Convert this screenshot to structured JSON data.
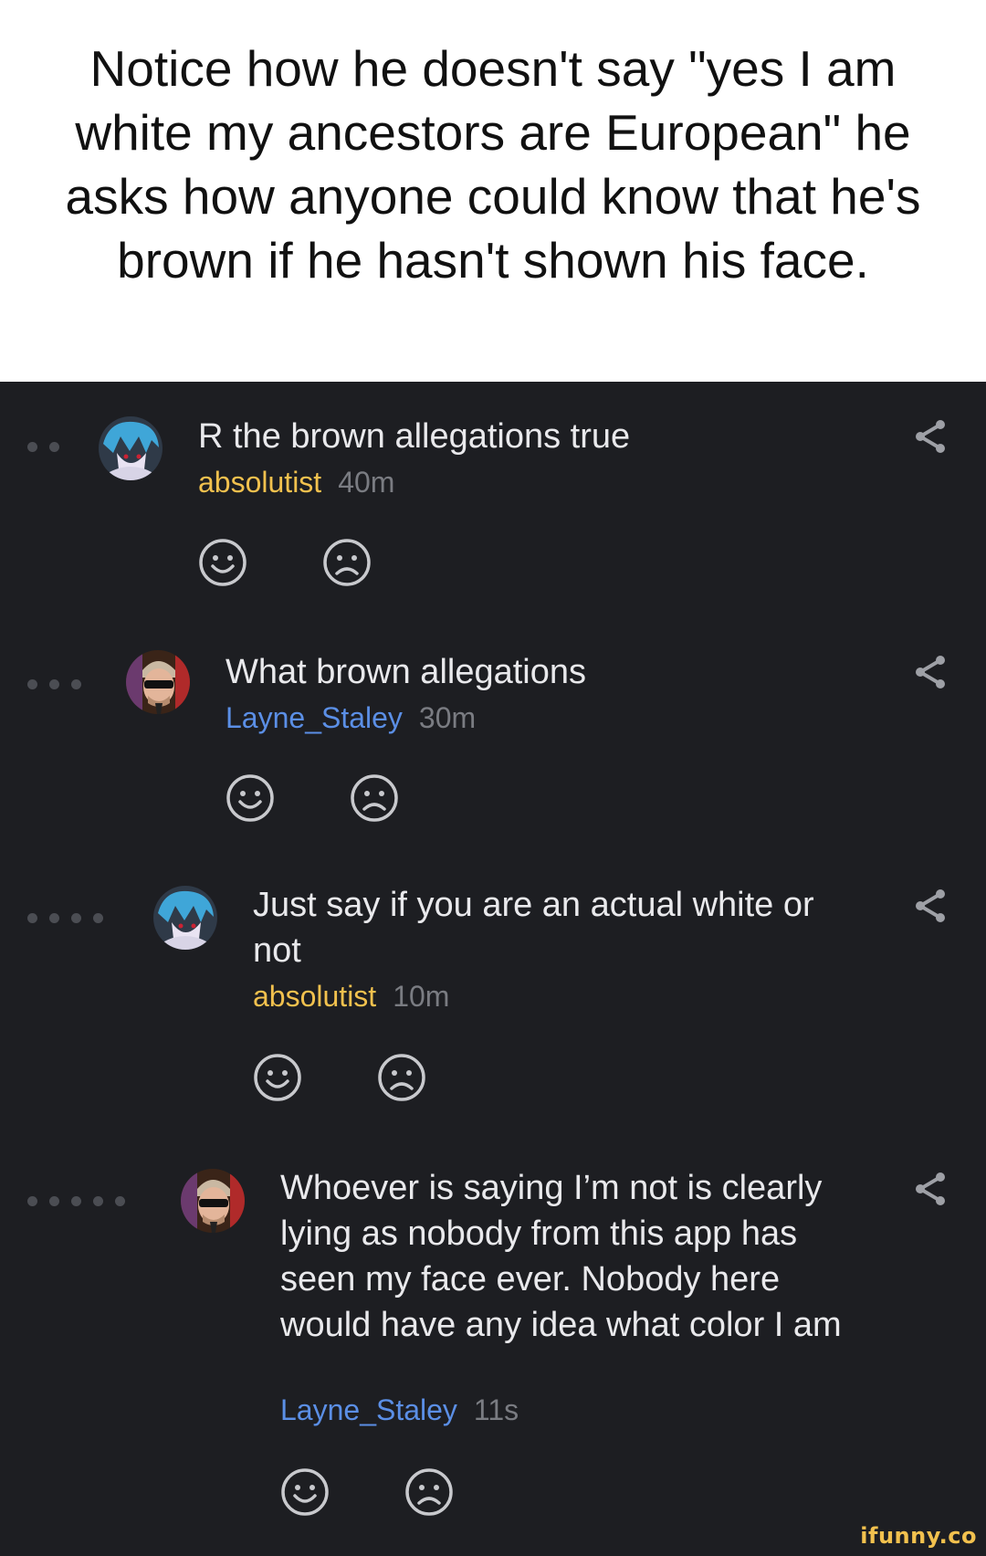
{
  "caption": {
    "text": "Notice how he doesn't say \"yes I am white my ancestors are European\" he asks how anyone could know that he's brown if he hasn't shown his face."
  },
  "comments": [
    {
      "text": "R the brown allegations true",
      "username": "absolutist",
      "time": "40m",
      "depth": 2,
      "user_color": "#f2c14e",
      "avatar": "anime-avatar"
    },
    {
      "text": "What brown allegations",
      "username": "Layne_Staley",
      "time": "30m",
      "depth": 3,
      "user_color": "#5b8fe6",
      "avatar": "sunglasses-avatar"
    },
    {
      "text": "Just say if you are an actual white or not",
      "username": "absolutist",
      "time": "10m",
      "depth": 4,
      "user_color": "#f2c14e",
      "avatar": "anime-avatar"
    },
    {
      "text": "Whoever is saying I’m not is clearly lying as nobody from this app has seen my face ever. Nobody here would have any idea what color I am",
      "username": "Layne_Staley",
      "time": "11s",
      "depth": 5,
      "user_color": "#5b8fe6",
      "avatar": "sunglasses-avatar"
    }
  ],
  "icons": {
    "like": "smile-icon",
    "dislike": "frown-icon",
    "share": "share-icon"
  },
  "watermark": "ifunny.co"
}
